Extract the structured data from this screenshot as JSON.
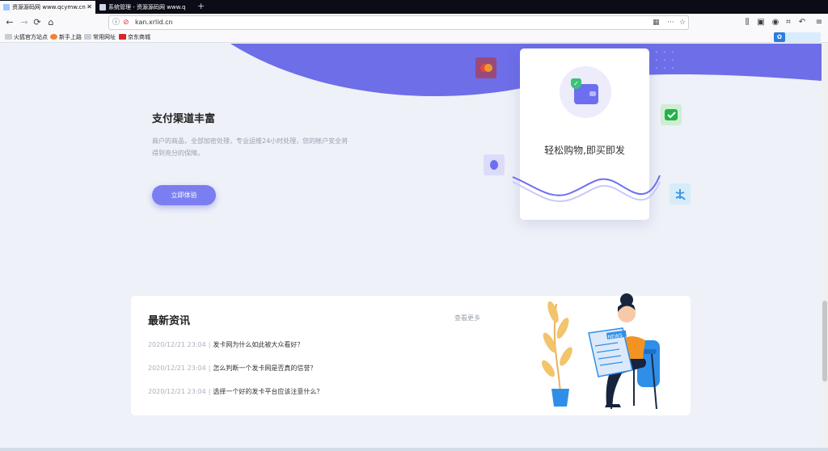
{
  "browser": {
    "tabs": [
      {
        "label": "资源源码网 www.qcymw.cn -",
        "active": true
      },
      {
        "label": "系统管理 - 资源源码网 www.q",
        "active": false
      }
    ],
    "url": "kan.xrlid.cn",
    "bookmarks": [
      "火狐官方站点",
      "新手上路",
      "常用网址",
      "京东商城"
    ]
  },
  "hero": {
    "title": "支付渠道丰富",
    "description": "商户的商品，全部加密处理，专业运维24小时处理，您的帐户安全将得到充分的保障。",
    "button_label": "立即体验"
  },
  "card": {
    "title": "轻松购物,即买即发"
  },
  "news": {
    "heading": "最新资讯",
    "more_label": "查看更多",
    "items": [
      {
        "date": "2020/12/21 23:04",
        "title": "发卡网为什么如此被大众看好？"
      },
      {
        "date": "2020/12/21 23:04",
        "title": "怎么判断一个发卡网是否真的信誉？"
      },
      {
        "date": "2020/12/21 23:04",
        "title": "选择一个好的发卡平台应该注意什么？"
      }
    ]
  },
  "illustration": {
    "newspaper_text": "NEWS"
  },
  "colors": {
    "accent": "#7b7ef0",
    "wave": "#6d6ee8",
    "background": "#eef1f8"
  }
}
